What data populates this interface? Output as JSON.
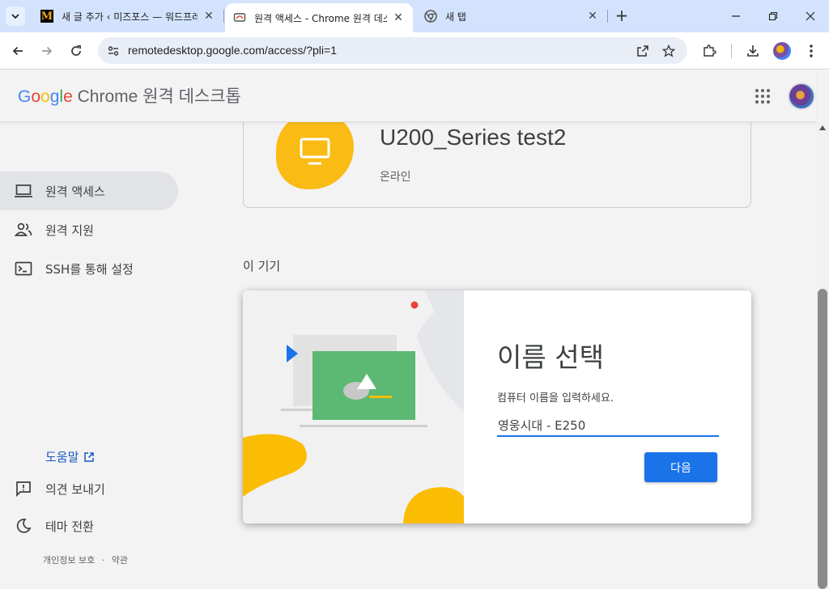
{
  "browser": {
    "tabs": [
      {
        "title": "새 글 추가 ‹ 미즈포스 — 워드프레스"
      },
      {
        "title": "원격 액세스 - Chrome 원격 데스크톱"
      },
      {
        "title": "새 탭"
      }
    ],
    "new_tab_label": "+",
    "url": "remotedesktop.google.com/access/?pli=1"
  },
  "header": {
    "brand_google": [
      "G",
      "o",
      "o",
      "g",
      "l",
      "e"
    ],
    "brand_product": " Chrome 원격 데스크톱"
  },
  "sidebar": {
    "items": [
      {
        "label": "원격 액세스"
      },
      {
        "label": "원격 지원"
      },
      {
        "label": "SSH를 통해 설정"
      }
    ],
    "help": "도움말",
    "feedback": "의견 보내기",
    "theme": "테마 전환",
    "privacy": "개인정보 보호",
    "separator": "·",
    "terms": "약관"
  },
  "device": {
    "name": "U200_Series test2",
    "status": "온라인"
  },
  "section": {
    "this_device": "이 기기"
  },
  "dialog": {
    "title": "이름 선택",
    "prompt": "컴퓨터 이름을 입력하세요.",
    "input_value": "영웅시대 - E250",
    "next_label": "다음"
  },
  "colors": {
    "accent": "#1a73e8",
    "device_blob": "#f9bb14",
    "art_green": "#5bb974",
    "art_yellow": "#fbbc04",
    "art_blue": "#1a73e8",
    "art_red": "#ea4335"
  }
}
